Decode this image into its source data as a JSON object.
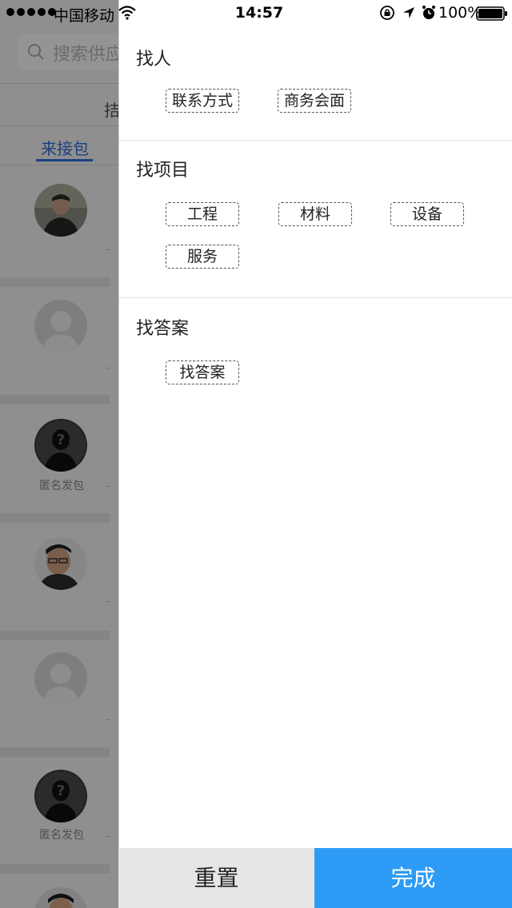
{
  "status_bar": {
    "carrier": "中国移动",
    "time": "14:57",
    "battery": "100%"
  },
  "background": {
    "search_placeholder": "搜索供应",
    "top_partial": "拮",
    "tab_label": "来接包",
    "anonymous_caption": "匿名发包",
    "accent_color": "#2d6ee0"
  },
  "drawer": {
    "sections": [
      {
        "title": "找人",
        "tags": [
          "联系方式",
          "商务会面"
        ]
      },
      {
        "title": "找项目",
        "tags": [
          "工程",
          "材料",
          "设备",
          "服务"
        ]
      },
      {
        "title": "找答案",
        "tags": [
          "找答案"
        ]
      }
    ]
  },
  "footer": {
    "reset_label": "重置",
    "done_label": "完成",
    "done_color": "#2e9bf6"
  }
}
